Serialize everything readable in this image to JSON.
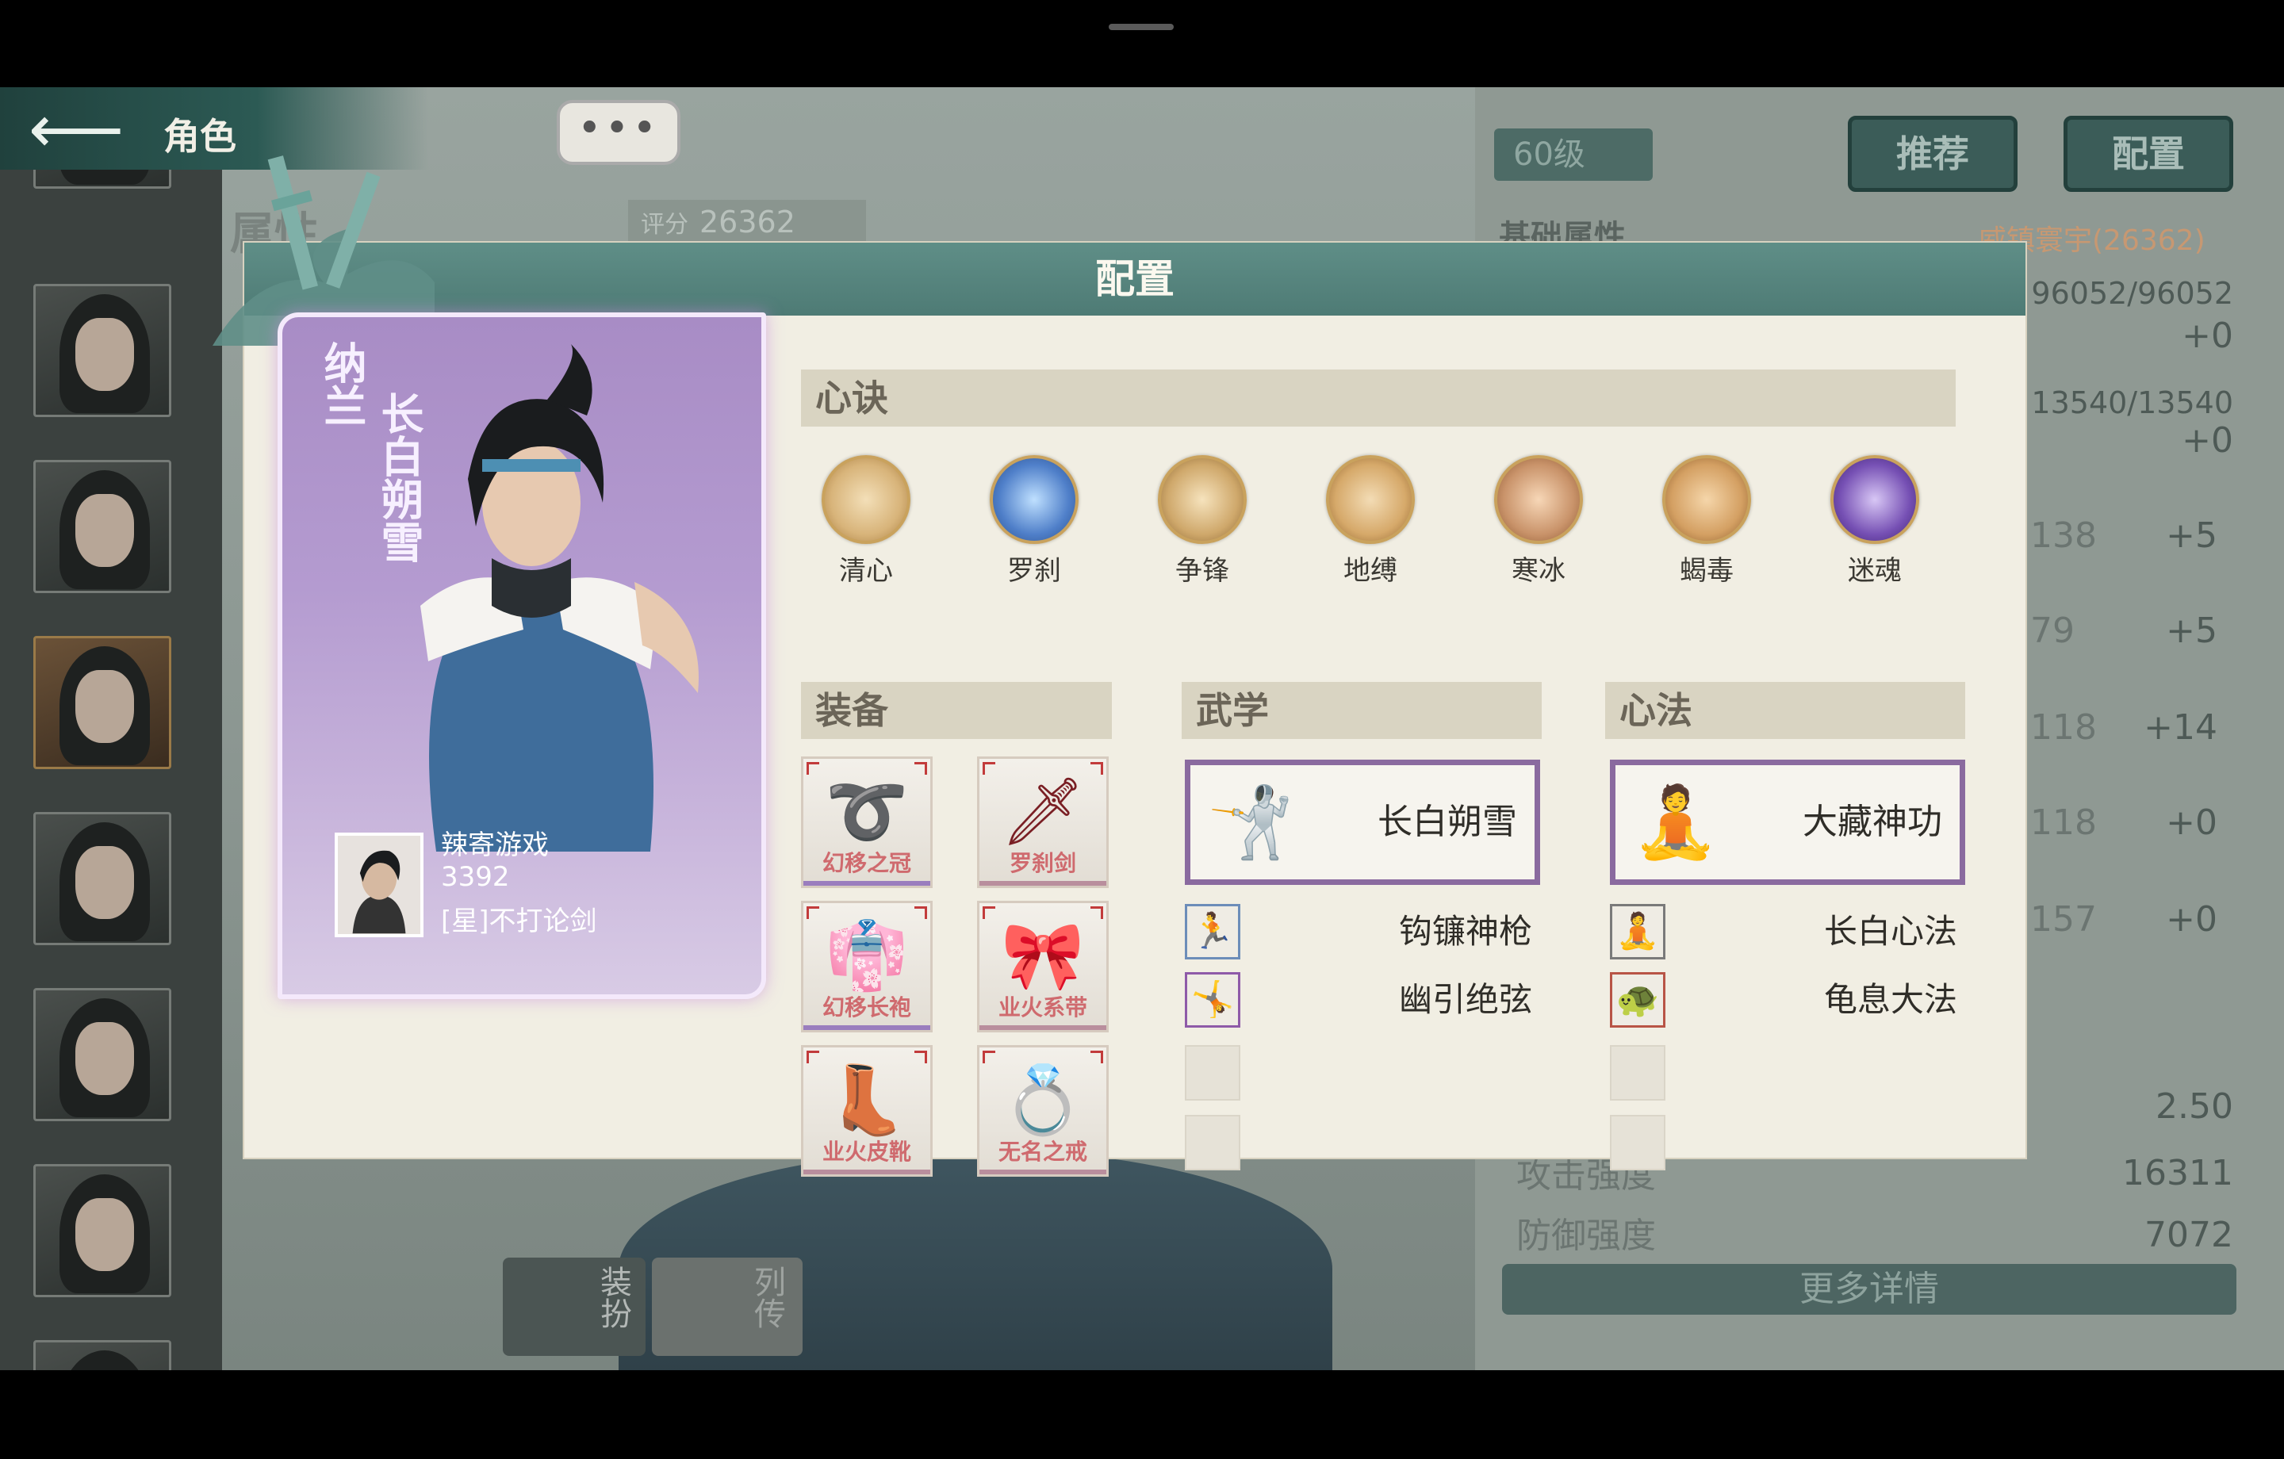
{
  "topbar": {
    "back_icon": "back-arrow-icon",
    "title": "角色",
    "chat_icon": "ellipsis-icon",
    "chat_text": "•••"
  },
  "background": {
    "attr_tab_label": "属性",
    "score_label": "评分",
    "score_value": "26362",
    "level": "60级",
    "btn_recommend": "推荐",
    "btn_config": "配置",
    "panel_title": "基础属性",
    "panel_owner": "威镇寰宇(26362)",
    "rows": [
      {
        "value": "96052/96052"
      },
      {
        "value": "+0"
      },
      {
        "value": "13540/13540"
      },
      {
        "value": "+0"
      },
      {
        "value": "138",
        "bonus": "+5"
      },
      {
        "value": "79",
        "bonus": "+5"
      },
      {
        "value": "118",
        "bonus": "+14"
      },
      {
        "value": "118",
        "bonus": "+0"
      },
      {
        "value": "157",
        "bonus": "+0"
      }
    ],
    "misc_value": "2.50",
    "attack_label": "攻击强度",
    "attack_value": "16311",
    "defense_label": "防御强度",
    "defense_value": "7072",
    "more_details": "更多详情",
    "dress_btn": "装扮",
    "biography_btn": "列传"
  },
  "modal": {
    "title": "配置",
    "character": {
      "surname": "纳兰",
      "title": "长白朔雪",
      "player_name": "辣寄游戏",
      "player_score": "3392",
      "player_title": "[星]不打论剑"
    },
    "xinjue": {
      "header": "心诀",
      "items": [
        {
          "label": "清心",
          "icon": "lotus-icon",
          "color": "#d8b47a"
        },
        {
          "label": "罗刹",
          "icon": "lightning-icon",
          "color": "#4f7fc9"
        },
        {
          "label": "争锋",
          "icon": "fist-icon",
          "color": "#cfa86b"
        },
        {
          "label": "地缚",
          "icon": "swirl-icon",
          "color": "#d6a96a"
        },
        {
          "label": "寒冰",
          "icon": "snowflake-icon",
          "color": "#c9936a"
        },
        {
          "label": "蝎毒",
          "icon": "scorpion-icon",
          "color": "#d4a063"
        },
        {
          "label": "迷魂",
          "icon": "spiral-icon",
          "color": "#7650b4"
        }
      ]
    },
    "equipment": {
      "header": "装备",
      "items": [
        {
          "label": "幻移之冠",
          "icon": "headband-icon"
        },
        {
          "label": "罗刹剑",
          "icon": "sword-icon"
        },
        {
          "label": "幻移长袍",
          "icon": "robe-icon"
        },
        {
          "label": "业火系带",
          "icon": "belt-icon"
        },
        {
          "label": "业火皮靴",
          "icon": "boots-icon"
        },
        {
          "label": "无名之戒",
          "icon": "ring-icon"
        }
      ]
    },
    "martial": {
      "header": "武学",
      "main": {
        "name": "长白朔雪",
        "icon": "swordsman-icon"
      },
      "subs": [
        {
          "name": "钩镰神枪",
          "icon": "spear-fighter-icon"
        },
        {
          "name": "幽引绝弦",
          "icon": "archer-fighter-icon"
        }
      ]
    },
    "heart": {
      "header": "心法",
      "main": {
        "name": "大藏神功",
        "icon": "meditating-monk-icon"
      },
      "subs": [
        {
          "name": "长白心法",
          "icon": "meditation-icon"
        },
        {
          "name": "龟息大法",
          "icon": "turtle-breath-icon"
        }
      ]
    }
  }
}
